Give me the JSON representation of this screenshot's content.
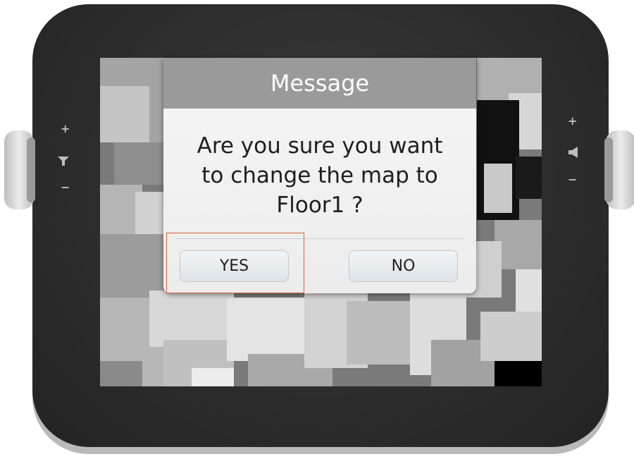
{
  "device": {
    "left_controls": {
      "plus": "+",
      "minus": "−",
      "icon": "mic-icon"
    },
    "right_controls": {
      "plus": "+",
      "minus": "−",
      "icon": "speaker-icon"
    }
  },
  "dialog": {
    "title": "Message",
    "message_line1": "Are you sure you want",
    "message_line2": "to change the map to",
    "message_line3": "Floor1 ?",
    "yes_label": "YES",
    "no_label": "NO"
  },
  "colors": {
    "header": "#9a9a9a",
    "focus_outline": "#d9603a"
  }
}
